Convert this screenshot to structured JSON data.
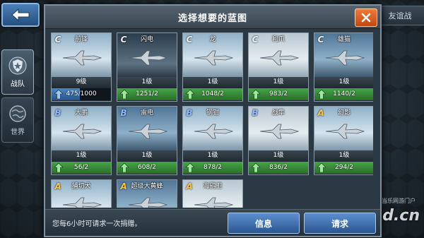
{
  "dialog": {
    "title": "选择想要的蓝图",
    "footer_note": "您每6小时可请求一次捐赠。",
    "info_label": "信息",
    "request_label": "请求"
  },
  "top_right_tab": "友谊战",
  "sidebar": {
    "items": [
      {
        "label": "战队",
        "icon": "shield-badge-icon",
        "active": true
      },
      {
        "label": "世界",
        "icon": "globe-icon",
        "active": false
      }
    ]
  },
  "cards": [
    {
      "name": "前锋",
      "grade": "C",
      "level": "9级",
      "progress_text": "475/1000",
      "progress": 0.475,
      "fill": "blue",
      "sky": "sky3"
    },
    {
      "name": "闪电",
      "grade": "C",
      "level": "1级",
      "progress_text": "1251/2",
      "progress": 1,
      "fill": "green",
      "sky": "sky2"
    },
    {
      "name": "龙",
      "grade": "C",
      "level": "1级",
      "progress_text": "1048/2",
      "progress": 1,
      "fill": "green",
      "sky": "sky3"
    },
    {
      "name": "利爪",
      "grade": "C",
      "level": "1级",
      "progress_text": "983/2",
      "progress": 1,
      "fill": "green",
      "sky": "sky4"
    },
    {
      "name": "雄猫",
      "grade": "C",
      "level": "1级",
      "progress_text": "1140/2",
      "progress": 1,
      "fill": "green",
      "sky": "sky5"
    },
    {
      "name": "大鹏",
      "grade": "B",
      "level": "1级",
      "progress_text": "56/2",
      "progress": 1,
      "fill": "green",
      "sky": "sky3"
    },
    {
      "name": "雷电",
      "grade": "B",
      "level": "1级",
      "progress_text": "608/2",
      "progress": 1,
      "fill": "green",
      "sky": "sky5"
    },
    {
      "name": "钢钳",
      "grade": "B",
      "level": "1级",
      "progress_text": "878/2",
      "progress": 1,
      "fill": "green",
      "sky": "sky3"
    },
    {
      "name": "战隼",
      "grade": "B",
      "level": "1级",
      "progress_text": "836/2",
      "progress": 1,
      "fill": "green",
      "sky": "sky4"
    },
    {
      "name": "幻影",
      "grade": "A",
      "level": "1级",
      "progress_text": "294/2",
      "progress": 1,
      "fill": "green",
      "sky": "sky3"
    },
    {
      "name": "捕切犬",
      "grade": "A",
      "level": "",
      "progress_text": "",
      "progress": 0,
      "fill": "green",
      "sky": "sky3"
    },
    {
      "name": "超级大黄蜂",
      "grade": "A",
      "level": "",
      "progress_text": "",
      "progress": 0,
      "fill": "green",
      "sky": "sky5"
    },
    {
      "name": "海鹞卫",
      "grade": "A",
      "level": "",
      "progress_text": "",
      "progress": 0,
      "fill": "green",
      "sky": "sky4"
    }
  ],
  "watermark": {
    "top": "当乐网游门户",
    "main": "d.cn"
  },
  "colors": {
    "accent": "#2a568f",
    "close": "#c44810",
    "progress_green": "#47a547",
    "progress_blue": "#4a86c9"
  }
}
